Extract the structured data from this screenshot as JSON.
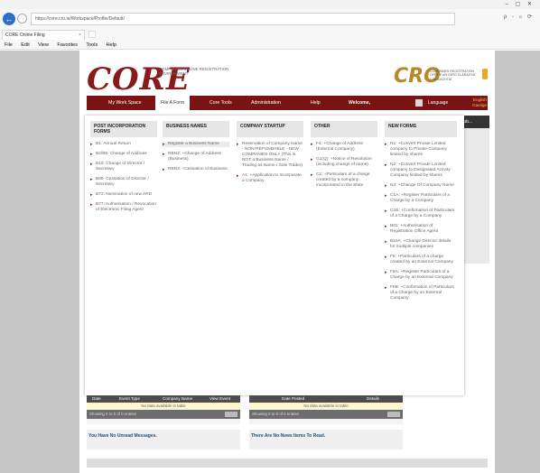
{
  "browser": {
    "window_controls": "–  ▢  ✕",
    "address": "https://core.cro.ie/Workspace/Profile/Default/",
    "address_right": "ρ - ⌂ ⟳",
    "tab_title": "CORE Online Filing",
    "tab_close": "×",
    "menu": [
      "File",
      "Edit",
      "View",
      "Favorites",
      "Tools",
      "Help"
    ]
  },
  "header": {
    "logo": "CORE",
    "logo_sub": "COMPANIES ONLINE REGISTRATION ENVIRONMENT",
    "cro": "CRO",
    "cro_sub": "COMPANIES REGISTRATION OFFICE AN OIFIG CLÁRAITHE CUIDEACHTAÍ"
  },
  "nav": {
    "items": [
      "My Work Space",
      "File A Form",
      "Core Tools",
      "Administration",
      "Help",
      "Welcome,"
    ],
    "language_label": "Language",
    "language_value": "English Gaeilge"
  },
  "dropdown": {
    "columns": [
      {
        "header": "POST INCORPORATION FORMS",
        "items": [
          "B1: Annual Return",
          "B2/B5: Change of Address",
          "B10: Change of Director / Secretary",
          "B69: Cessation of Director / Secretary",
          "B73: Nomination of new ARD",
          "B77: Authorisation / Revocation of Electronic Filing Agent"
        ]
      },
      {
        "header": "BUSINESS NAMES",
        "items": [
          "Register a Business Name",
          "RBN2: +Change of Address (Business)",
          "RBN3: +Cessation of Business"
        ]
      },
      {
        "header": "COMPANY STARTUP",
        "items": [
          "Reservation of Company Name - NON-REFUNDABLE - NEW COMPANIES ONLY (This is NOT a Business Name / Trading as Name / Sole Trader)",
          "A1: +Application to Incorporate a Company"
        ]
      },
      {
        "header": "OTHER",
        "items": [
          "F4: +Change of Address (External Company)",
          "G1(Q): +Notice of Resolution (including change of name)",
          "C1: +Particulars of a charge created by a company incorporated in the State"
        ]
      },
      {
        "header": "NEW FORMS",
        "items": [
          "N1: +Convert Private Limited company to Private Company limited by shares",
          "N2: +Convert Private Limited company to Designated Activity Company limited by shares",
          "N3: +Change Of Company Name",
          "C1A: +Register Particulars of a Charge by a Company",
          "C1B: +Confirmation of Particulars of a Charge by a Company",
          "B81: +Authorisation of Registration Office Agent",
          "B10A: +Change Director details for multiple companies",
          "F6: +Particulars of a charge created by an External Company",
          "F8A: +Register Particulars of a Charge by an External Company",
          "F8B: +Confirmation of Particulars of a Charge by an External Company"
        ]
      }
    ]
  },
  "portlet_peek": "Sub...",
  "tables": [
    {
      "headers": [
        "Date",
        "Event Type",
        "Company Name",
        "View Event"
      ],
      "empty": "No data available in table",
      "footer": "Showing 0 to 0 of 0 entries"
    },
    {
      "headers": [
        "Date Posted",
        "Details"
      ],
      "empty": "No data available in table",
      "footer": "Showing 0 to 0 of 0 entries"
    }
  ],
  "messages": {
    "unread": "You Have No Unread Messages.",
    "news": "There Are No News Items To Read."
  }
}
